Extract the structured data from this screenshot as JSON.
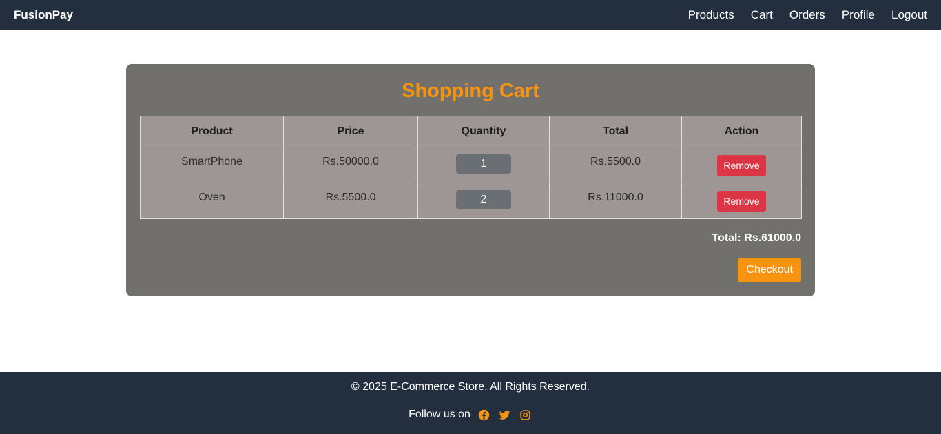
{
  "navbar": {
    "brand": "FusionPay",
    "links": [
      "Products",
      "Cart",
      "Orders",
      "Profile",
      "Logout"
    ]
  },
  "cart": {
    "title": "Shopping Cart",
    "headers": [
      "Product",
      "Price",
      "Quantity",
      "Total",
      "Action"
    ],
    "rows": [
      {
        "product": "SmartPhone",
        "price": "Rs.50000.0",
        "quantity": "1",
        "total": "Rs.5500.0",
        "action": "Remove"
      },
      {
        "product": "Oven",
        "price": "Rs.5500.0",
        "quantity": "2",
        "total": "Rs.11000.0",
        "action": "Remove"
      }
    ],
    "grand_total": "Total: Rs.61000.0",
    "checkout_label": "Checkout"
  },
  "footer": {
    "copyright": "© 2025 E-Commerce Store. All Rights Reserved.",
    "follow_text": "Follow us on",
    "social_icons": [
      "facebook-icon",
      "twitter-icon",
      "instagram-icon"
    ]
  },
  "colors": {
    "nav_bg": "#232f3e",
    "accent": "#f7940f",
    "danger": "#dc3545",
    "card_bg": "#72706d",
    "table_bg": "#9e9694"
  }
}
